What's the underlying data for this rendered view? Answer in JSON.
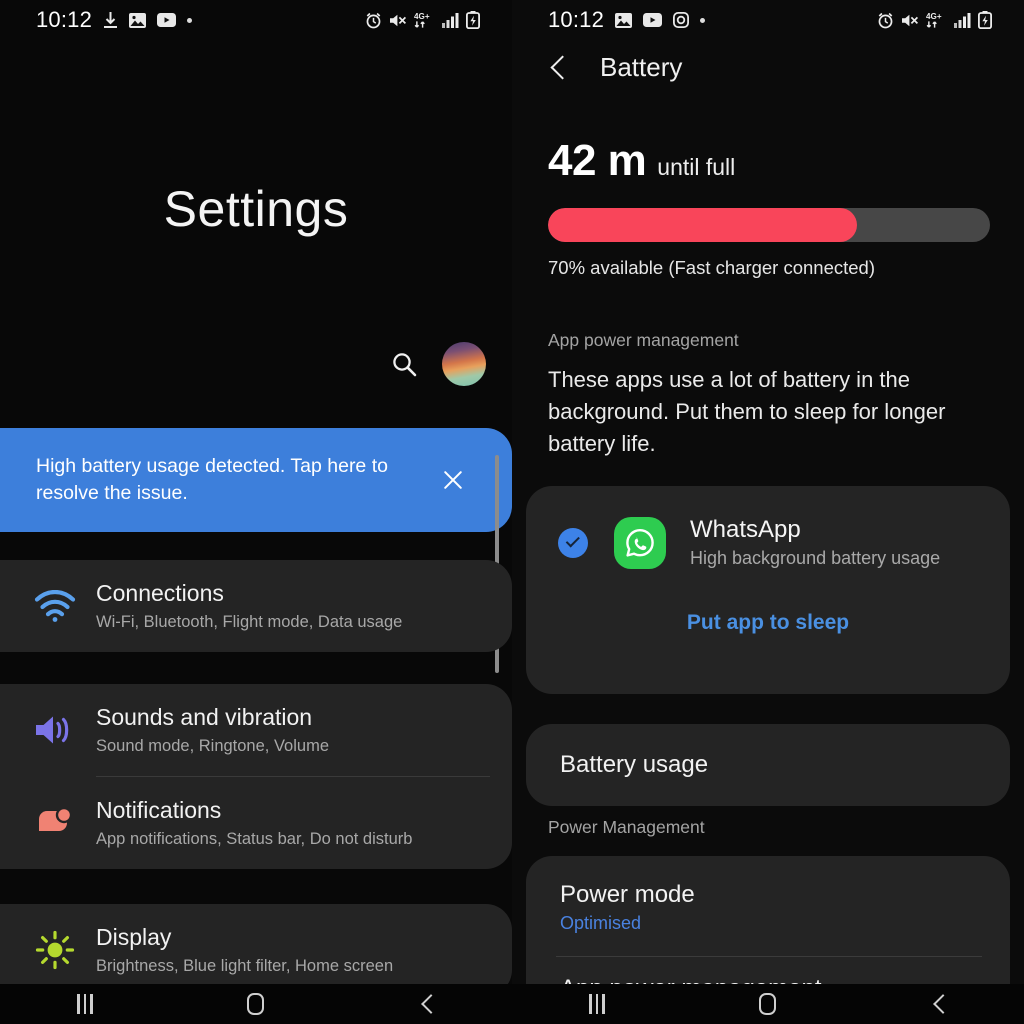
{
  "left": {
    "statusbar": {
      "time": "10:12",
      "left_icons": [
        "download-icon",
        "gallery-icon",
        "youtube-icon",
        "dot-icon"
      ],
      "right_icons": [
        "alarm-icon",
        "mute-icon",
        "network-4g-plus-icon",
        "signal-bars-icon",
        "battery-charging-icon"
      ],
      "network_label": "4G+"
    },
    "title": "Settings",
    "search_icon": "search-icon",
    "avatar": "profile-avatar",
    "banner": {
      "text": "High battery usage detected. Tap here to resolve the issue.",
      "close_icon": "close-icon",
      "color": "#3d7fdb"
    },
    "items": [
      {
        "title": "Connections",
        "subtitle": "Wi-Fi, Bluetooth, Flight mode, Data usage",
        "icon": "wifi-icon",
        "icon_color": "#5aa0ec"
      },
      {
        "title": "Sounds and vibration",
        "subtitle": "Sound mode, Ringtone, Volume",
        "icon": "volume-icon",
        "icon_color": "#7b74e8"
      },
      {
        "title": "Notifications",
        "subtitle": "App notifications, Status bar, Do not disturb",
        "icon": "notification-bubble-icon",
        "icon_color": "#f08273"
      },
      {
        "title": "Display",
        "subtitle": "Brightness, Blue light filter, Home screen",
        "icon": "brightness-sun-icon",
        "icon_color": "#b5d92e"
      }
    ]
  },
  "right": {
    "statusbar": {
      "time": "10:12",
      "left_icons": [
        "gallery-icon",
        "youtube-icon",
        "instagram-icon",
        "dot-icon"
      ],
      "right_icons": [
        "alarm-icon",
        "mute-icon",
        "network-4g-plus-icon",
        "signal-bars-icon",
        "battery-charging-icon"
      ],
      "network_label": "4G+"
    },
    "back_icon": "back-chevron-icon",
    "title": "Battery",
    "battery": {
      "time_value": "42 m",
      "time_suffix": "until full",
      "percent": 70,
      "percent_text": "70% available (Fast charger connected)",
      "fill_color": "#f9455a",
      "track_color": "#474747"
    },
    "app_power": {
      "section_label": "App power management",
      "description": "These apps use a lot of battery in the background. Put them to sleep for longer battery life.",
      "app": {
        "name": "WhatsApp",
        "subtitle": "High background battery usage",
        "icon": "whatsapp-icon",
        "icon_color": "#2ecc50",
        "checked": true,
        "checkbox_color": "#3d82e8"
      },
      "action_label": "Put app to sleep",
      "action_color": "#4a90e2"
    },
    "battery_usage_label": "Battery usage",
    "power_management_label": "Power Management",
    "power_mode": {
      "title": "Power mode",
      "value": "Optimised",
      "value_color": "#4a82e0"
    },
    "app_power_management_row": "App power management"
  },
  "navbar": {
    "recents": "recents-icon",
    "home": "home-icon",
    "back": "back-icon"
  }
}
